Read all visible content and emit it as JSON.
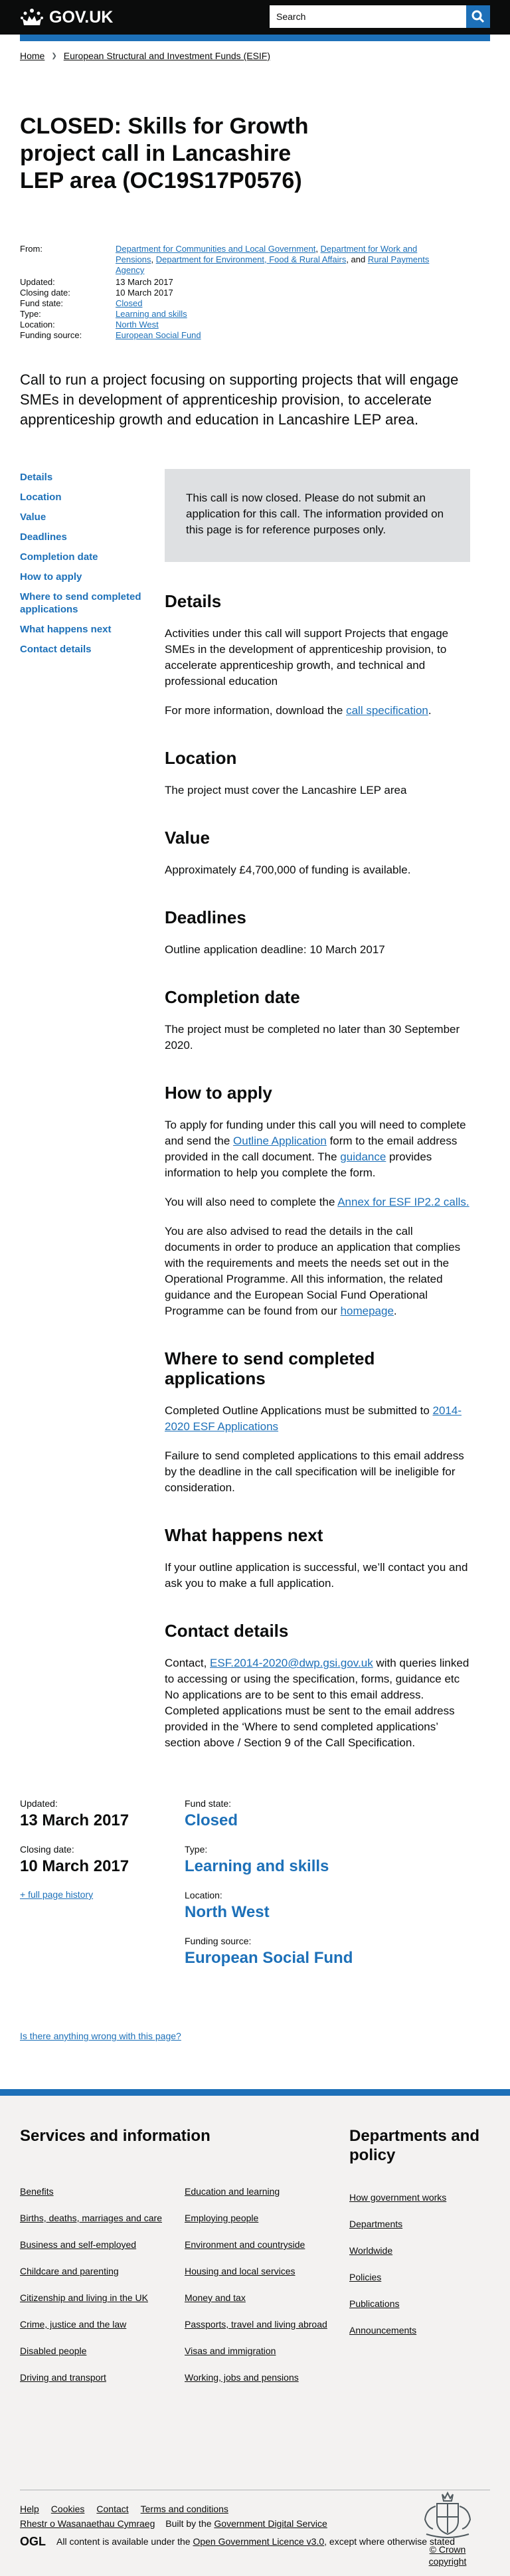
{
  "header": {
    "logo_text": "GOV.UK",
    "search_placeholder": "Search"
  },
  "breadcrumb": [
    {
      "label": "Home"
    },
    {
      "label": "European Structural and Investment Funds (ESIF)"
    }
  ],
  "title": "CLOSED: Skills for Growth project call in Lancashire LEP area (OC19S17P0576)",
  "meta": {
    "from_label": "From:",
    "from_links": [
      "Department for Communities and Local Government",
      "Department for Work and Pensions",
      "Department for Environment, Food & Rural Affairs",
      "Rural Payments Agency"
    ],
    "updated_label": "Updated:",
    "updated": "13 March 2017",
    "closing_label": "Closing date:",
    "closing": "10 March 2017",
    "fund_state_label": "Fund state:",
    "fund_state": "Closed",
    "type_label": "Type:",
    "type": "Learning and skills",
    "location_label": "Location:",
    "location": "North West",
    "funding_label": "Funding source:",
    "funding": "European Social Fund"
  },
  "lead": "Call to run a project focusing on supporting projects that will engage SMEs in development of apprenticeship provision, to accelerate apprenticeship growth and education in Lancashire LEP area.",
  "contents": [
    "Details",
    "Location",
    "Value",
    "Deadlines",
    "Completion date",
    "How to apply",
    "Where to send completed applications",
    "What happens next",
    "Contact details"
  ],
  "notice": "This call is now closed. Please do not submit an application for this call. The information provided on this page is for reference purposes only.",
  "sections": {
    "details": {
      "heading": "Details",
      "p1": "Activities under this call will support Projects that engage SMEs in the development of apprenticeship provision, to accelerate apprenticeship growth, and technical and professional education",
      "p2_prefix": "For more information, download the ",
      "p2_link": "call specification",
      "p2_suffix": "."
    },
    "location": {
      "heading": "Location",
      "p": "The project must cover the Lancashire LEP area"
    },
    "value": {
      "heading": "Value",
      "p": "Approximately £4,700,000 of funding is available."
    },
    "deadlines": {
      "heading": "Deadlines",
      "p": "Outline application deadline: 10 March 2017"
    },
    "completion": {
      "heading": "Completion date",
      "p": "The project must be completed no later than 30 September 2020."
    },
    "apply": {
      "heading": "How to apply",
      "p1_a": "To apply for funding under this call you will need to complete and send the ",
      "p1_link1": "Outline Application",
      "p1_b": " form to the email address provided in the call document. The ",
      "p1_link2": "guidance",
      "p1_c": " provides information to help you complete the form.",
      "p2_a": "You will also need to complete the ",
      "p2_link": "Annex for ESF IP2.2 calls.",
      "p3_a": "You are also advised to read the details in the call documents in order to produce an application that complies with the requirements and meets the needs set out in the Operational Programme. All this information, the related guidance and the European Social Fund Operational Programme can be found from our ",
      "p3_link": "homepage",
      "p3_b": "."
    },
    "send": {
      "heading": "Where to send completed applications",
      "p1_a": "Completed Outline Applications must be submitted to ",
      "p1_link": "2014-2020 ESF Applications",
      "p2": "Failure to send completed applications to this email address by the deadline in the call specification will be ineligible for consideration."
    },
    "next": {
      "heading": "What happens next",
      "p": "If your outline application is successful, we’ll contact you and ask you to make a full application."
    },
    "contact": {
      "heading": "Contact details",
      "p_a": "Contact, ",
      "p_link": "ESF.2014-2020@dwp.gsi.gov.uk",
      "p_b": " with queries linked to accessing or using the specification, forms, guidance etc No applications are to be sent to this email address. Completed applications must be sent to the email address provided in the ‘Where to send completed applications’ section above / Section 9 of the Call Specification."
    }
  },
  "footer_meta": {
    "updated_label": "Updated:",
    "updated": "13 March 2017",
    "closing_label": "Closing date:",
    "closing": "10 March 2017",
    "history": "+ full page history",
    "fund_state_label": "Fund state:",
    "fund_state": "Closed",
    "type_label": "Type:",
    "type": "Learning and skills",
    "location_label": "Location:",
    "location": "North West",
    "funding_label": "Funding source:",
    "funding": "European Social Fund"
  },
  "report": "Is there anything wrong with this page?",
  "footer": {
    "services_heading": "Services and information",
    "services_col1": [
      "Benefits",
      "Births, deaths, marriages and care",
      "Business and self-employed",
      "Childcare and parenting",
      "Citizenship and living in the UK",
      "Crime, justice and the law",
      "Disabled people",
      "Driving and transport"
    ],
    "services_col2": [
      "Education and learning",
      "Employing people",
      "Environment and countryside",
      "Housing and local services",
      "Money and tax",
      "Passports, travel and living abroad",
      "Visas and immigration",
      "Working, jobs and pensions"
    ],
    "departments_heading": "Departments and policy",
    "departments": [
      "How government works",
      "Departments",
      "Worldwide",
      "Policies",
      "Publications",
      "Announcements"
    ],
    "meta_links": [
      "Help",
      "Cookies",
      "Contact",
      "Terms and conditions"
    ],
    "welsh": "Rhestr o Wasanaethau Cymraeg",
    "built_by_prefix": "Built by the ",
    "built_by_link": "Government Digital Service",
    "ogl_logo": "OGL",
    "licence_a": "All content is available under the ",
    "licence_link": "Open Government Licence v3.0",
    "licence_b": ", except where otherwise stated",
    "crown": "© Crown copyright"
  }
}
